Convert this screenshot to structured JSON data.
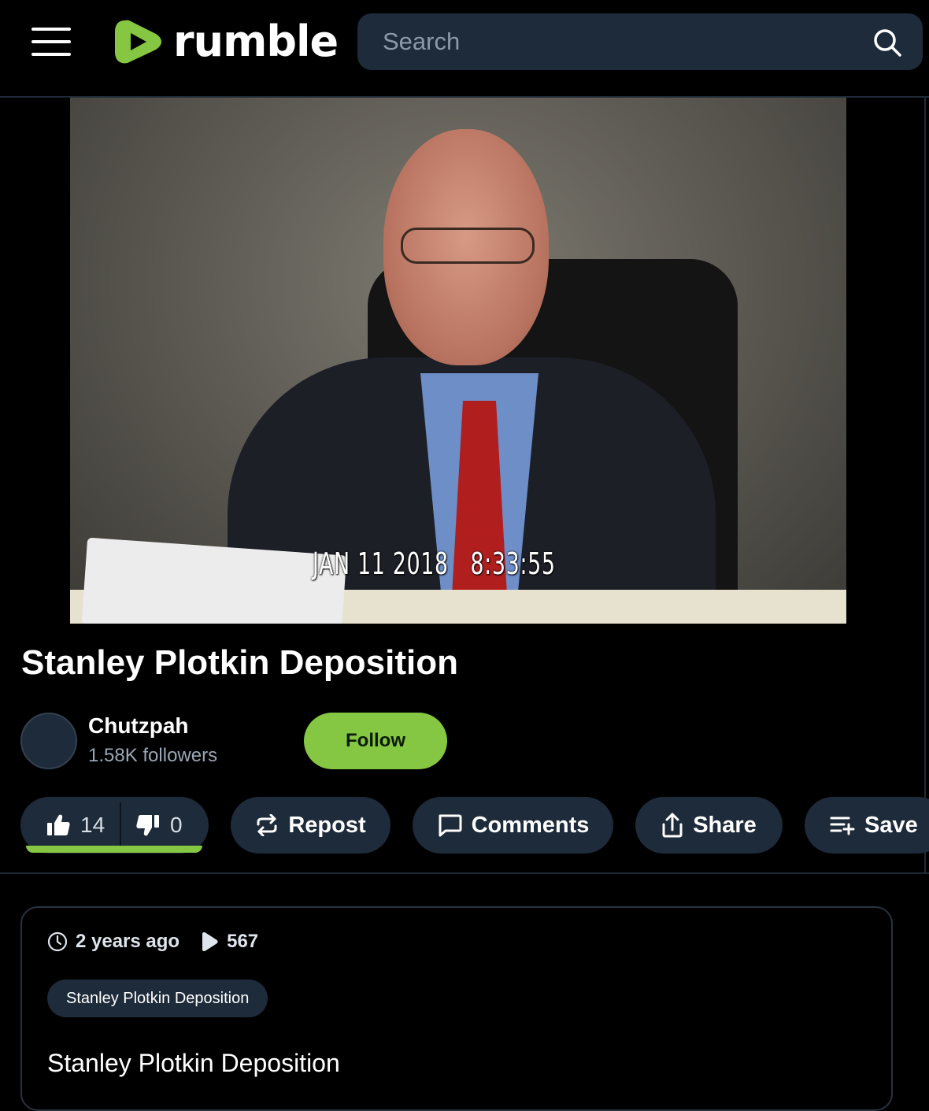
{
  "header": {
    "brand": "rumble",
    "search_placeholder": "Search"
  },
  "video": {
    "timestamp": "JAN 11 2018   8:33:55",
    "title": "Stanley Plotkin Deposition"
  },
  "channel": {
    "name": "Chutzpah",
    "followers": "1.58K followers",
    "follow_label": "Follow"
  },
  "actions": {
    "likes": "14",
    "dislikes": "0",
    "like_ratio": 1.0,
    "repost": "Repost",
    "comments": "Comments",
    "share": "Share",
    "save": "Save"
  },
  "details": {
    "age": "2 years ago",
    "views": "567",
    "tag": "Stanley Plotkin Deposition",
    "description": "Stanley Plotkin Deposition"
  },
  "colors": {
    "brand_green": "#85c742",
    "pill_bg": "#1e2b3a",
    "background": "#000000"
  }
}
